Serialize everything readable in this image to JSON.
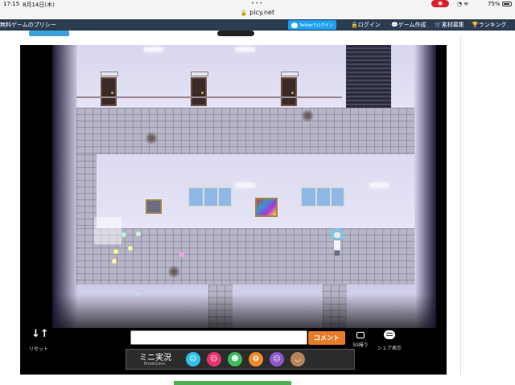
{
  "status": {
    "time": "17:15",
    "date": "8月14日(木)",
    "battery": "75%"
  },
  "browser": {
    "url": "picy.net",
    "dots": "•••"
  },
  "nav": {
    "brand": "無料ゲームのプリシー",
    "twitter_label": "Twitterでログイン",
    "login_label": "ログイン",
    "create_label": "ゲーム作成",
    "materials_label": "素材募集",
    "ranking_label": "ランキング"
  },
  "game_ui": {
    "reset_label": "リセット",
    "comment_placeholder": "",
    "comment_button": "コメント",
    "ss_label": "SS撮り",
    "share_label": "シェア表示",
    "emote_title": "ミニ実況",
    "emote_sub": "Emoticons",
    "emotes": [
      {
        "name": "happy",
        "color": "#2ec1e8",
        "glyph": "☺"
      },
      {
        "name": "sad",
        "color": "#e8336d",
        "glyph": "☹"
      },
      {
        "name": "laugh",
        "color": "#3dbb5c",
        "glyph": "☻"
      },
      {
        "name": "surprised",
        "color": "#f2892a",
        "glyph": "ʘ"
      },
      {
        "name": "angry",
        "color": "#8c57c9",
        "glyph": "☹"
      },
      {
        "name": "neutral",
        "color": "#b5835a",
        "glyph": "◡"
      }
    ]
  }
}
